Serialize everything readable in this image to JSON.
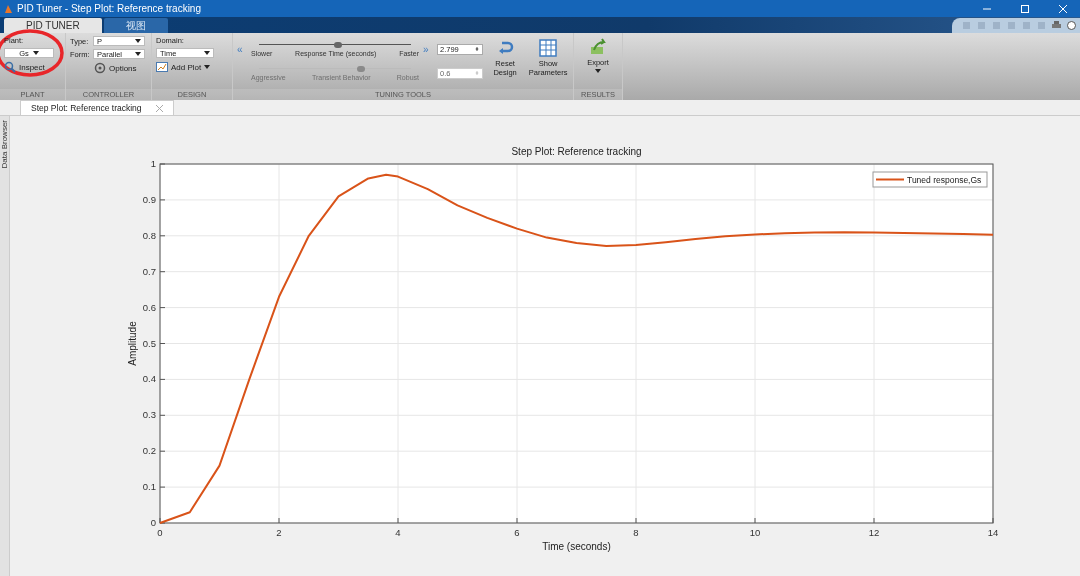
{
  "window": {
    "title": "PID Tuner - Step Plot: Reference tracking"
  },
  "ribbon_tabs": [
    {
      "label": "PID TUNER",
      "selected": true
    },
    {
      "label": "视图",
      "selected": false
    }
  ],
  "plant": {
    "label": "Plant:",
    "value": "Gs",
    "inspect": "Inspect",
    "section": "PLANT"
  },
  "controller": {
    "type_label": "Type:",
    "type_value": "P",
    "form_label": "Form:",
    "form_value": "Parallel",
    "options": "Options",
    "section": "CONTROLLER"
  },
  "design": {
    "domain_label": "Domain:",
    "domain_value": "Time",
    "add_plot": "Add Plot",
    "section": "DESIGN"
  },
  "tuning_tools": {
    "sliders": [
      {
        "left": "Slower",
        "center": "Response Time (seconds)",
        "right": "Faster",
        "level": 0.52,
        "value": "2.799",
        "disabled": false
      },
      {
        "left": "Aggressive",
        "center": "Transient Behavior",
        "right": "Robust",
        "level": 0.67,
        "value": "0.6",
        "disabled": true
      }
    ],
    "slower": "«",
    "faster": "»",
    "reset": "Reset Design",
    "show": "Show Parameters",
    "section": "TUNING TOOLS"
  },
  "results": {
    "export": "Export",
    "section": "RESULTS"
  },
  "annotation": {
    "color": "#e8262a"
  },
  "side_tab": "Data Browser",
  "document_tabs": [
    {
      "label": "Step Plot: Reference tracking",
      "selected": true
    }
  ],
  "plot": {
    "chart_data": {
      "type": "line",
      "title": "Step Plot: Reference tracking",
      "xlabel": "Time (seconds)",
      "ylabel": "Amplitude",
      "x": [
        0,
        0.5,
        1,
        1.5,
        2,
        2.5,
        3,
        3.5,
        3.8,
        4,
        4.5,
        5,
        5.5,
        6,
        6.5,
        7,
        7.5,
        8,
        8.5,
        9,
        9.5,
        10,
        10.5,
        11,
        11.5,
        12,
        12.5,
        13,
        13.5,
        14
      ],
      "series": [
        {
          "name": "Tuned response,Gs",
          "color": "#d95319",
          "values": [
            0,
            0.03,
            0.16,
            0.4,
            0.63,
            0.8,
            0.91,
            0.96,
            0.97,
            0.965,
            0.93,
            0.885,
            0.85,
            0.82,
            0.795,
            0.78,
            0.772,
            0.774,
            0.782,
            0.791,
            0.799,
            0.804,
            0.807,
            0.809,
            0.81,
            0.809,
            0.808,
            0.806,
            0.805,
            0.803
          ]
        }
      ],
      "grid": true,
      "xlim": [
        0,
        14
      ],
      "ylim": [
        0,
        1
      ],
      "xticks": [
        0,
        2,
        4,
        6,
        8,
        10,
        12,
        14
      ],
      "yticks": [
        0,
        0.1,
        0.2,
        0.3,
        0.4,
        0.5,
        0.6,
        0.7,
        0.8,
        0.9,
        1
      ]
    }
  }
}
